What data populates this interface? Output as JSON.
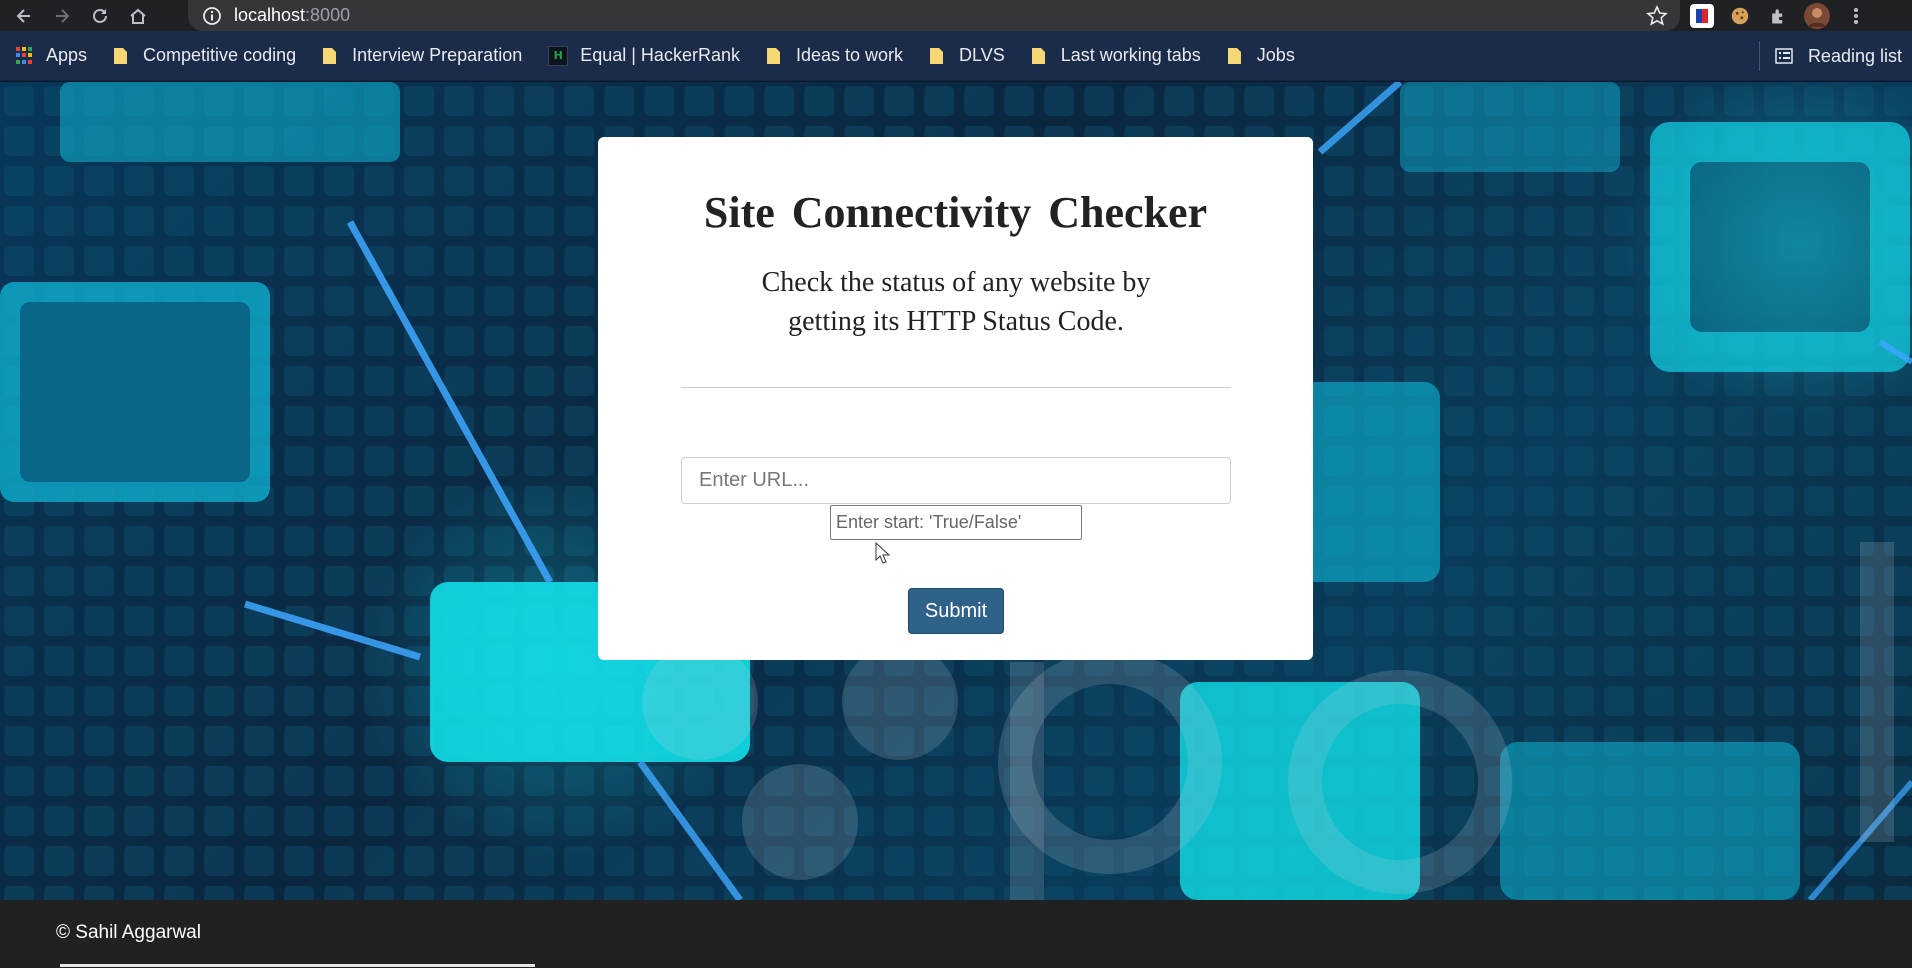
{
  "browser": {
    "url_host": "localhost",
    "url_port": ":8000",
    "nav": {
      "back_icon": "back-arrow-icon",
      "forward_icon": "forward-arrow-icon",
      "reload_icon": "reload-icon",
      "home_icon": "home-icon"
    }
  },
  "bookmarks": {
    "items": [
      {
        "label": "Apps",
        "icon": "apps-grid-icon"
      },
      {
        "label": "Competitive coding",
        "icon": "folder-icon"
      },
      {
        "label": "Interview Preparation",
        "icon": "folder-icon"
      },
      {
        "label": "Equal | HackerRank",
        "icon": "hackerrank-icon"
      },
      {
        "label": "Ideas to work",
        "icon": "folder-icon"
      },
      {
        "label": "DLVS",
        "icon": "folder-icon"
      },
      {
        "label": "Last working tabs",
        "icon": "folder-icon"
      },
      {
        "label": "Jobs",
        "icon": "folder-icon"
      }
    ],
    "reading_list": "Reading list",
    "colors": {
      "folder": "#f7d774",
      "bar": "#1b2c4a"
    }
  },
  "card": {
    "title": "Site Connectivity Checker",
    "description": "Check the status of any website by getting its HTTP Status Code.",
    "url_placeholder": "Enter URL...",
    "url_value": "",
    "start_placeholder": "Enter start: 'True/False'",
    "start_value": "",
    "submit_label": "Submit",
    "submit_color": "#2f6289"
  },
  "footer": {
    "copyright": "© Sahil Aggarwal",
    "background": "#212121"
  }
}
